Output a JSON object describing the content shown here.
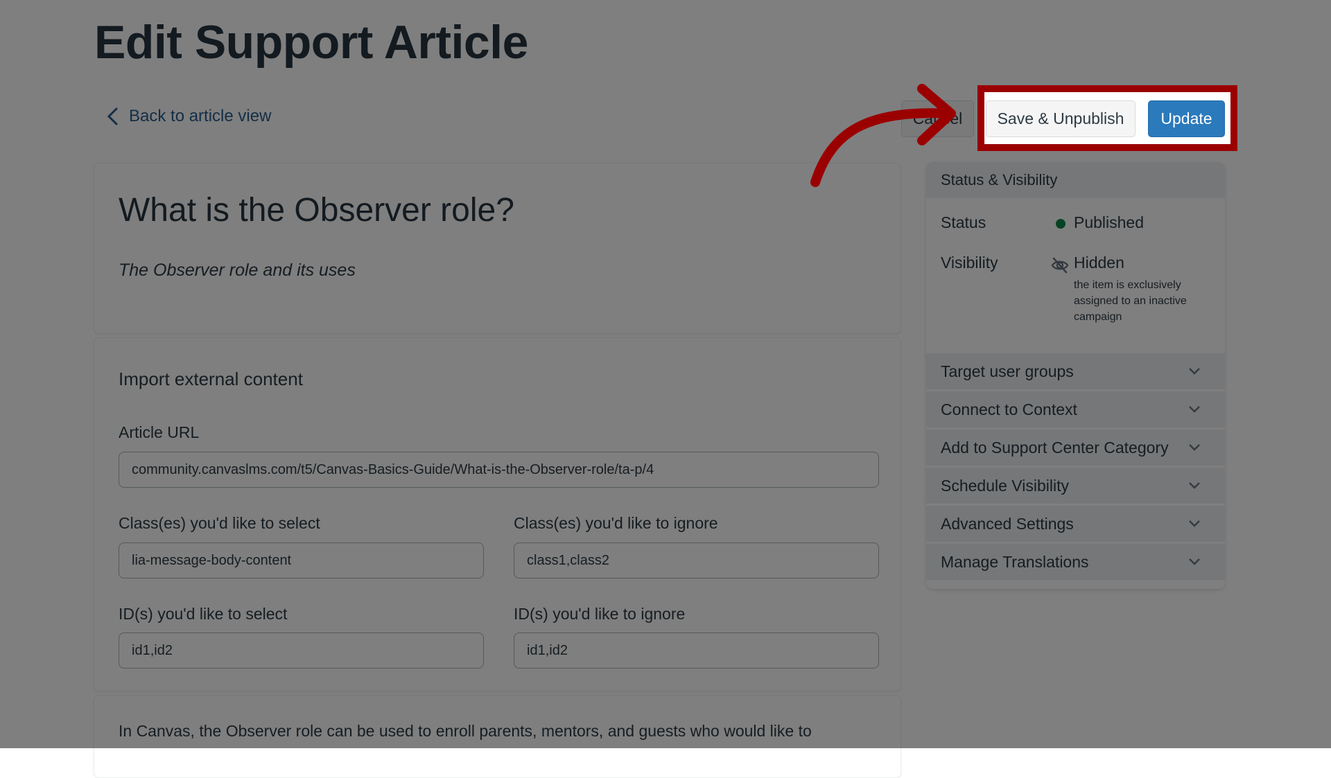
{
  "page": {
    "title": "Edit Support Article",
    "back_link": "Back to article view"
  },
  "actions": {
    "cancel": "Cancel",
    "save_unpublish": "Save & Unpublish",
    "update": "Update"
  },
  "article": {
    "title": "What is the Observer role?",
    "subtitle": "The Observer role and its uses"
  },
  "import": {
    "heading": "Import external content",
    "url_label": "Article URL",
    "url_value": "community.canvaslms.com/t5/Canvas-Basics-Guide/What-is-the-Observer-role/ta-p/4",
    "class_select_label": "Class(es) you'd like to select",
    "class_select_value": "lia-message-body-content",
    "class_ignore_label": "Class(es) you'd like to ignore",
    "class_ignore_value": "class1,class2",
    "id_select_label": "ID(s) you'd like to select",
    "id_select_value": "id1,id2",
    "id_ignore_label": "ID(s) you'd like to ignore",
    "id_ignore_value": "id1,id2"
  },
  "body": {
    "text": "In Canvas, the Observer role can be used to enroll parents, mentors, and guests who would like to"
  },
  "side_panel": {
    "header": "Status & Visibility",
    "status_label": "Status",
    "status_value": "Published",
    "visibility_label": "Visibility",
    "visibility_value": "Hidden",
    "visibility_note": "the item is exclusively assigned to an inactive campaign",
    "sections": [
      {
        "label": "Target user groups"
      },
      {
        "label": "Connect to Context"
      },
      {
        "label": "Add to Support Center Category"
      },
      {
        "label": "Schedule Visibility"
      },
      {
        "label": "Advanced Settings"
      },
      {
        "label": "Manage Translations"
      }
    ]
  },
  "colors": {
    "accent": "#2b7abc",
    "highlight": "#9b0000",
    "status_published": "#0b874b",
    "overlay": "#808080"
  },
  "icons": {
    "back": "chevron-left-icon",
    "status": "status-dot-icon",
    "visibility": "eye-slash-icon",
    "section_toggle": "chevron-down-icon",
    "annotation": "curved-arrow-icon"
  }
}
